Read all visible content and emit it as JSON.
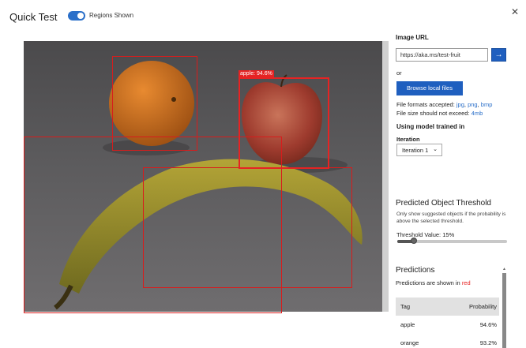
{
  "header": {
    "title": "Quick Test",
    "toggle_label": "Regions Shown",
    "toggle_on": true,
    "close_icon": "close-icon"
  },
  "image_panel": {
    "detections": [
      {
        "label": "apple: 94.6%",
        "tag": "apple",
        "strong": true
      }
    ],
    "zoom_icon": "fit-to-screen-icon"
  },
  "side": {
    "image_url_label": "Image URL",
    "image_url_value": "https://aka.ms/test-fruit",
    "or_text": "or",
    "browse_label": "Browse local files",
    "formats_prefix": "File formats accepted:",
    "formats": [
      "jpg",
      "png",
      "bmp"
    ],
    "size_prefix": "File size should not exceed:",
    "size_value": "4mb",
    "model_label": "Using model trained in",
    "iteration_label": "Iteration",
    "iteration_value": "Iteration 1",
    "threshold_heading": "Predicted Object Threshold",
    "threshold_desc_1": "Only show suggested objects if the probability is",
    "threshold_desc_2": "above the selected threshold.",
    "threshold_value_label": "Threshold Value: 15%",
    "threshold_fraction": 0.15,
    "predictions_heading": "Predictions",
    "predictions_note": "Predictions are shown in",
    "predictions_note_color": "red",
    "table": {
      "headers": [
        "Tag",
        "Probability"
      ],
      "rows": [
        {
          "tag": "apple",
          "probability": "94.6%"
        },
        {
          "tag": "orange",
          "probability": "93.2%"
        }
      ]
    }
  },
  "colors": {
    "accent": "#1f5fbf",
    "box": "#e62323"
  }
}
